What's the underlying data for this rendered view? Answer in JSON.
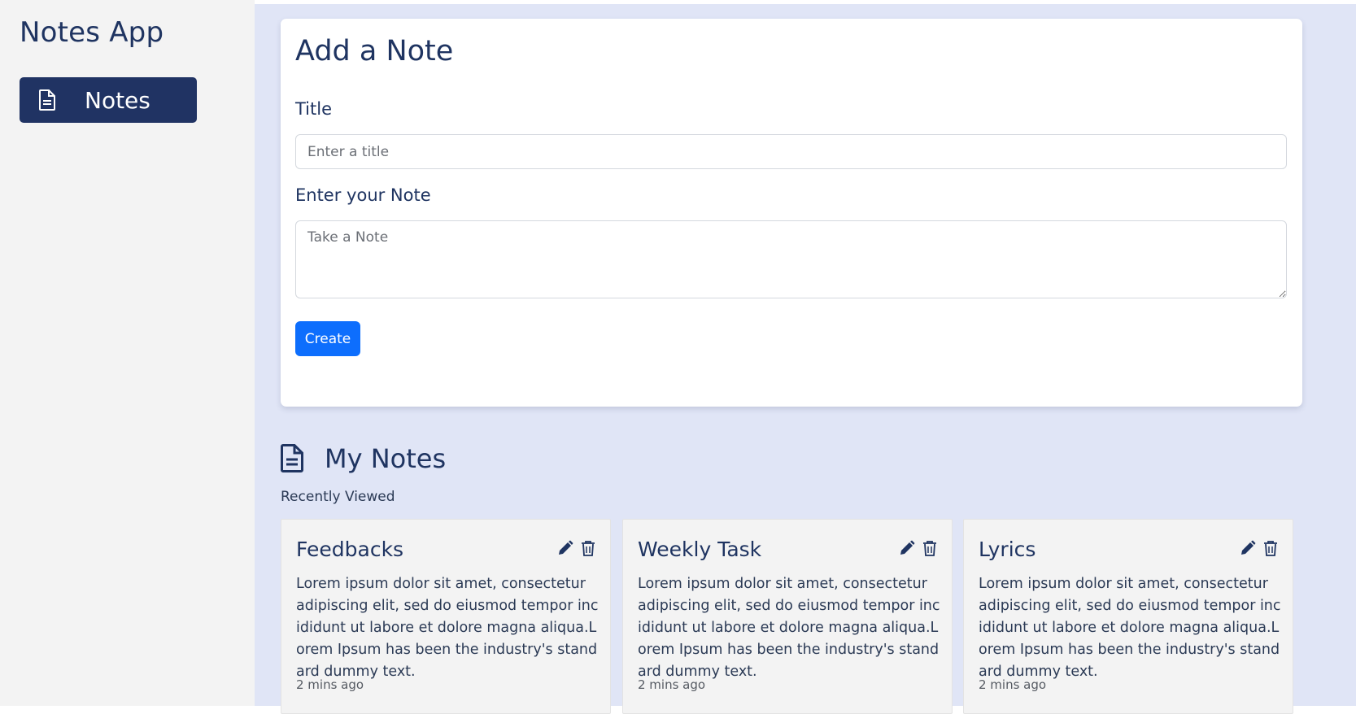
{
  "sidebar": {
    "brand": "Notes App",
    "items": [
      {
        "label": "Notes",
        "icon": "file-text-icon",
        "active": true
      }
    ]
  },
  "form": {
    "heading": "Add a Note",
    "title_label": "Title",
    "title_placeholder": "Enter a title",
    "title_value": "",
    "note_label": "Enter your Note",
    "note_placeholder": "Take a Note",
    "note_value": "",
    "create_label": "Create"
  },
  "notes_section": {
    "heading": "My Notes",
    "subheading": "Recently Viewed",
    "notes": [
      {
        "title": "Feedbacks",
        "body": "Lorem ipsum dolor sit amet, consectetur adipiscing elit, sed do eiusmod tempor incididunt ut labore et dolore magna aliqua.Lorem Ipsum has been the industry's standard dummy text.",
        "time": "2 mins ago"
      },
      {
        "title": "Weekly Task",
        "body": "Lorem ipsum dolor sit amet, consectetur adipiscing elit, sed do eiusmod tempor incididunt ut labore et dolore magna aliqua.Lorem Ipsum has been the industry's standard dummy text.",
        "time": "2 mins ago"
      },
      {
        "title": "Lyrics",
        "body": "Lorem ipsum dolor sit amet, consectetur adipiscing elit, sed do eiusmod tempor incididunt ut labore et dolore magna aliqua.Lorem Ipsum has been the industry's standard dummy text.",
        "time": "2 mins ago"
      }
    ]
  },
  "colors": {
    "brand_navy": "#203363",
    "text_navy": "#1f3461",
    "primary_button": "#0d6efd",
    "main_background": "#e0e5f6",
    "sidebar_background": "#f3f3f3"
  }
}
